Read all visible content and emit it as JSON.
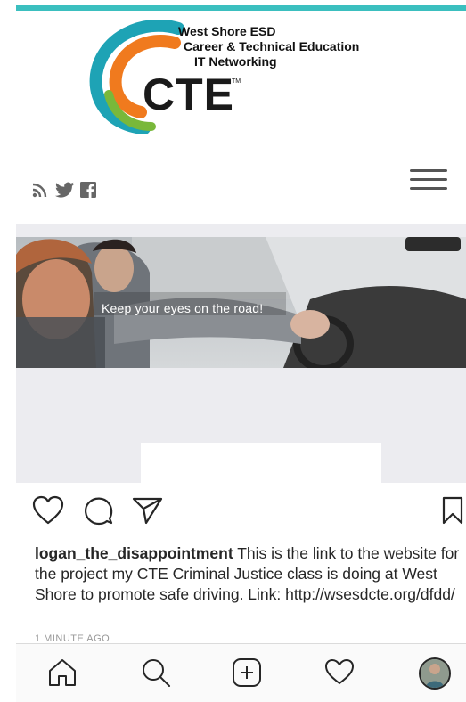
{
  "header": {
    "logo": {
      "line1": "West Shore ESD",
      "line2": "Career & Technical Education",
      "line3": "IT Networking",
      "mark": "CTE",
      "tm": "TM"
    },
    "social_icons": [
      "rss-icon",
      "twitter-icon",
      "facebook-icon"
    ],
    "menu_icon": "hamburger-menu-icon"
  },
  "post": {
    "image_caption": "Keep your eyes on the road!",
    "actions": [
      "heart-icon",
      "comment-icon",
      "share-icon",
      "bookmark-icon"
    ],
    "username": "logan_the_disappointment",
    "caption": " This is the link to the website for the project my CTE Criminal Justice class is doing at West Shore to promote safe driving. Link: http://wsesdcte.org/dfdd/",
    "time_ago": "1 MINUTE AGO"
  },
  "tabbar": {
    "items": [
      "home-icon",
      "search-icon",
      "new-post-icon",
      "activity-icon",
      "profile-avatar"
    ]
  },
  "colors": {
    "accent_bar": "#3bbfbf",
    "logo_teal": "#1ea3b5",
    "logo_orange": "#f07a1e",
    "logo_green": "#79b83a"
  }
}
